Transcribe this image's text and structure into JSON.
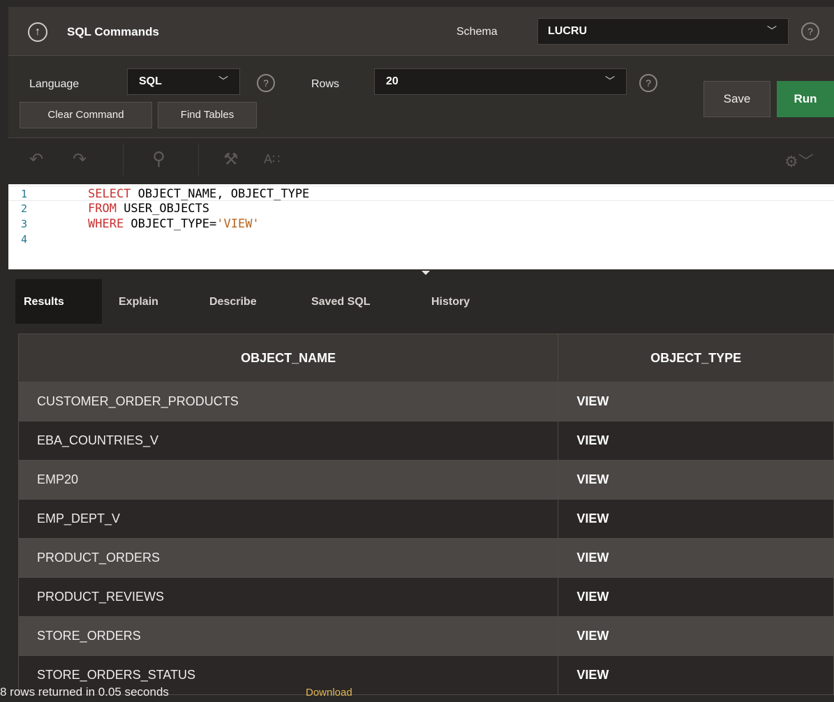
{
  "header": {
    "title": "SQL Commands",
    "schema_label": "Schema",
    "schema_value": "LUCRU",
    "up_icon": "arrow-up-icon",
    "help_icon": "help-icon"
  },
  "options": {
    "language_label": "Language",
    "language_value": "SQL",
    "rows_label": "Rows",
    "rows_value": "20",
    "clear_command_label": "Clear Command",
    "find_tables_label": "Find Tables",
    "save_label": "Save",
    "run_label": "Run"
  },
  "editor_toolbar": {
    "undo_icon": "undo-icon",
    "redo_icon": "redo-icon",
    "search_icon": "search-icon",
    "format_icon": "hammer-icon",
    "autocomplete_label": "A∷",
    "settings_icon": "gear-icon"
  },
  "editor": {
    "lines": [
      {
        "number": "1",
        "keyword": "SELECT",
        "rest": " OBJECT_NAME, OBJECT_TYPE"
      },
      {
        "number": "2",
        "keyword": "FROM",
        "rest": " USER_OBJECTS"
      },
      {
        "number": "3",
        "keyword": "WHERE",
        "rest": " OBJECT_TYPE=",
        "string": "'VIEW'"
      },
      {
        "number": "4",
        "keyword": "",
        "rest": ""
      }
    ]
  },
  "tabs": [
    "Results",
    "Explain",
    "Describe",
    "Saved SQL",
    "History"
  ],
  "results": {
    "columns": [
      "OBJECT_NAME",
      "OBJECT_TYPE"
    ],
    "rows": [
      [
        "CUSTOMER_ORDER_PRODUCTS",
        "VIEW"
      ],
      [
        "EBA_COUNTRIES_V",
        "VIEW"
      ],
      [
        "EMP20",
        "VIEW"
      ],
      [
        "EMP_DEPT_V",
        "VIEW"
      ],
      [
        "PRODUCT_ORDERS",
        "VIEW"
      ],
      [
        "PRODUCT_REVIEWS",
        "VIEW"
      ],
      [
        "STORE_ORDERS",
        "VIEW"
      ],
      [
        "STORE_ORDERS_STATUS",
        "VIEW"
      ]
    ],
    "status": "8 rows returned in 0.05 seconds",
    "download_label": "Download"
  },
  "colors": {
    "run_button": "#2e8046",
    "keyword": "#c8302e",
    "string": "#b5651d",
    "download_link": "#e1b655"
  }
}
